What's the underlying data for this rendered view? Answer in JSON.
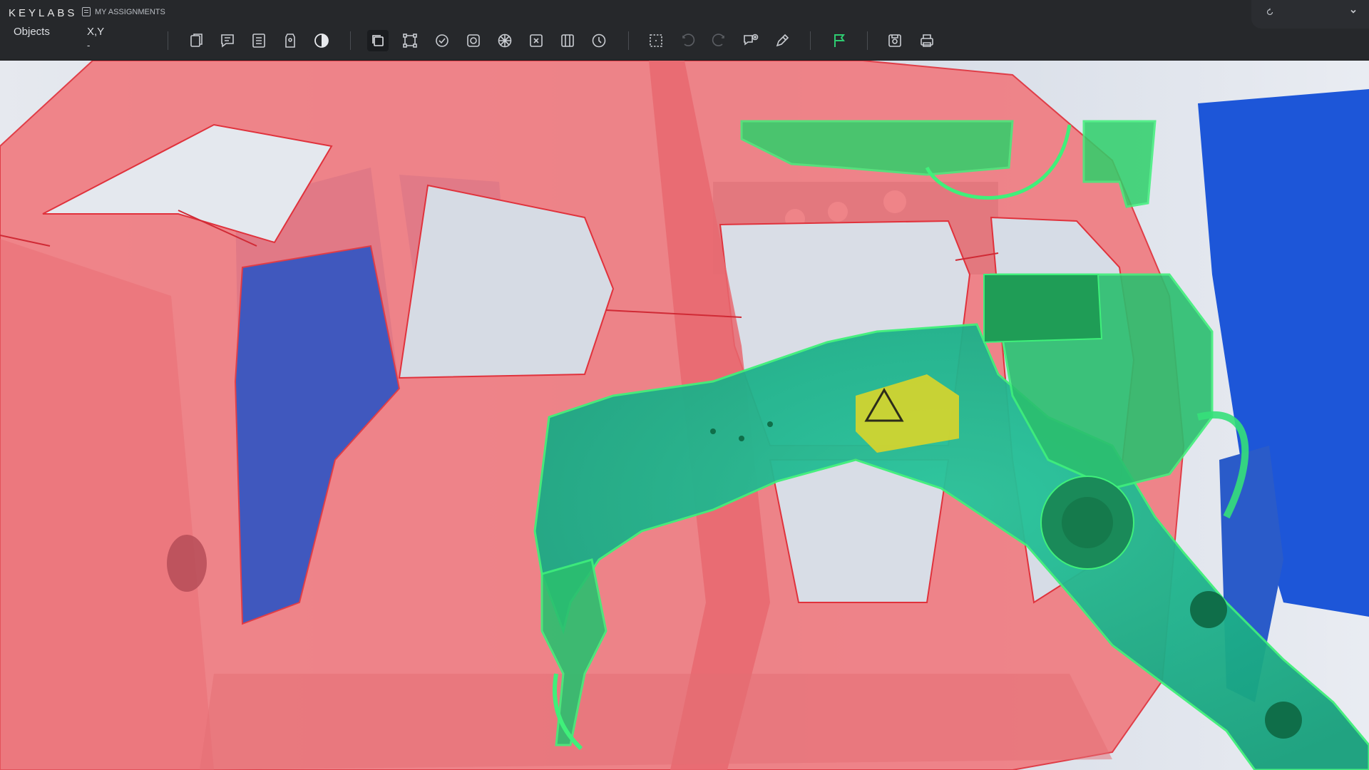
{
  "app": {
    "logo": "KEYLABS",
    "assignments_label": "MY ASSIGNMENTS"
  },
  "panel": {
    "objects_label": "Objects",
    "xy_label": "X,Y",
    "xy_value": "-"
  },
  "toolbar": {
    "groups": [
      [
        "copy-icon",
        "comment-icon",
        "list-icon",
        "tag-icon",
        "contrast-icon"
      ],
      [
        "polygon-icon",
        "keypoints-icon",
        "auto-segment-icon",
        "smart-segment-icon",
        "mesh-icon",
        "box-select-icon",
        "grid-icon",
        "rotate-icon"
      ],
      [
        "selection-icon",
        "undo-icon",
        "redo-icon",
        "comment-add-icon",
        "pen-icon"
      ],
      [
        "flag-icon"
      ],
      [
        "save-icon",
        "print-icon"
      ]
    ]
  },
  "annotations": [
    {
      "label": "car-body",
      "color": "#e8535a"
    },
    {
      "label": "robot-arm",
      "color": "#22d45a"
    }
  ],
  "colors": {
    "topbar": "#26282b",
    "accent_flag": "#2ecc71",
    "car_body_fill": "#f07d82",
    "robot_fill": "#1fb58f"
  }
}
